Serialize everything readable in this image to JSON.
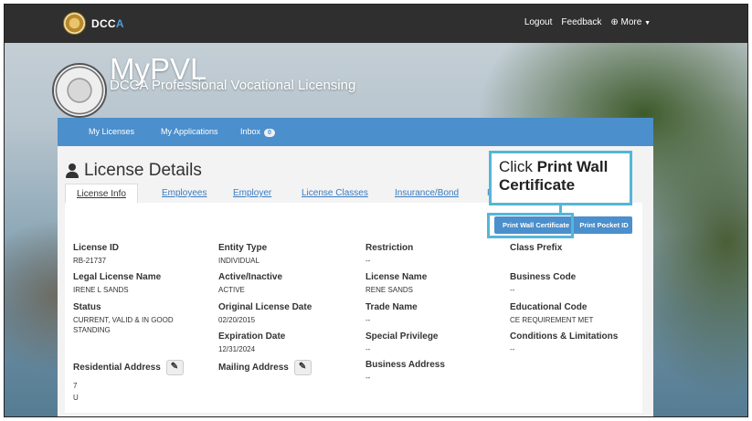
{
  "brand": {
    "logo_prefix": "DCC",
    "logo_accent": "A"
  },
  "topnav": {
    "logout": "Logout",
    "feedback": "Feedback",
    "more": "⊕ More",
    "more_caret": "▼"
  },
  "header": {
    "title": "MyPVL",
    "subtitle": "DCCA Professional Vocational Licensing"
  },
  "nav": {
    "my_licenses": "My Licenses",
    "my_applications": "My Applications",
    "inbox": "Inbox",
    "inbox_count": "0"
  },
  "page": {
    "title": "License Details"
  },
  "tabs": [
    "License Info",
    "Employees",
    "Employer",
    "License Classes",
    "Insurance/Bond",
    "F"
  ],
  "buttons": {
    "print_wall": "Print Wall Certificate",
    "print_pocket": "Print Pocket ID"
  },
  "callout": {
    "prefix": "Click ",
    "bold": "Print Wall Certificate"
  },
  "fields": {
    "license_id": {
      "label": "License ID",
      "value": "RB-21737"
    },
    "entity_type": {
      "label": "Entity Type",
      "value": "INDIVIDUAL"
    },
    "restriction": {
      "label": "Restriction",
      "value": "--"
    },
    "class_prefix": {
      "label": "Class Prefix",
      "value": ""
    },
    "legal_name": {
      "label": "Legal License Name",
      "value": "IRENE L SANDS"
    },
    "active_inactive": {
      "label": "Active/Inactive",
      "value": "ACTIVE"
    },
    "license_name": {
      "label": "License Name",
      "value": "RENE SANDS"
    },
    "business_code": {
      "label": "Business Code",
      "value": "--"
    },
    "status": {
      "label": "Status",
      "value": "CURRENT, VALID & IN GOOD STANDING"
    },
    "original_date": {
      "label": "Original License Date",
      "value": "02/20/2015"
    },
    "trade_name": {
      "label": "Trade Name",
      "value": "--"
    },
    "educational_code": {
      "label": "Educational Code",
      "value": "CE REQUIREMENT MET"
    },
    "expiration_date": {
      "label": "Expiration Date",
      "value": "12/31/2024"
    },
    "special_privilege": {
      "label": "Special Privilege",
      "value": "--"
    },
    "conditions": {
      "label": "Conditions & Limitations",
      "value": "--"
    },
    "residential_address": {
      "label": "Residential Address",
      "line1": "7",
      "line2": "U"
    },
    "mailing_address": {
      "label": "Mailing Address"
    },
    "business_address": {
      "label": "Business Address",
      "value": "--"
    }
  }
}
